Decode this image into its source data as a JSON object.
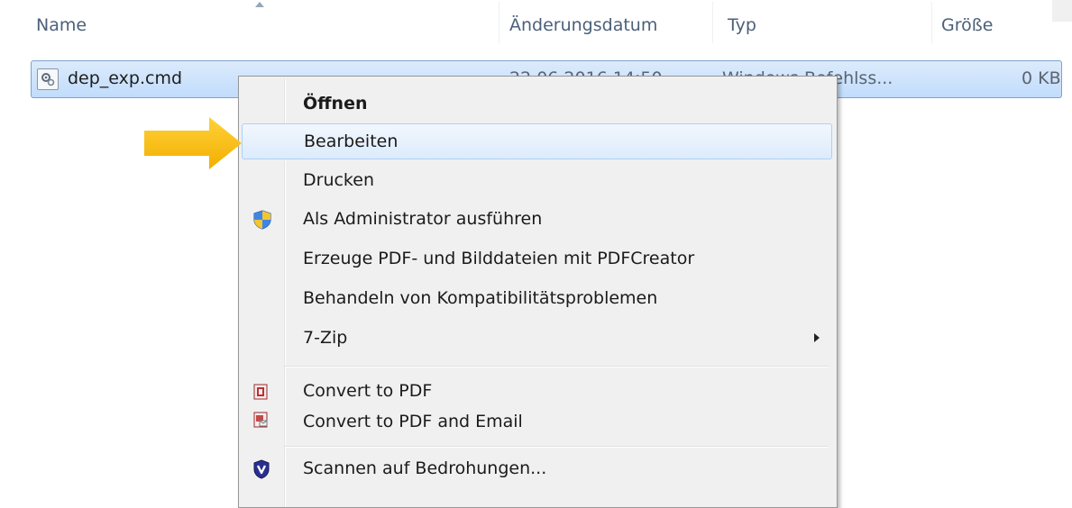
{
  "columns": {
    "name": "Name",
    "modified": "Änderungsdatum",
    "type": "Typ",
    "size": "Größe"
  },
  "file": {
    "icon": "cmd-script-icon",
    "name": "dep_exp.cmd",
    "modified": "22.06.2016 14:50",
    "type": "Windows-Befehlss...",
    "size": "0 KB"
  },
  "context_menu": {
    "items": [
      {
        "label": "Öffnen",
        "bold": true
      },
      {
        "label": "Bearbeiten",
        "highlighted": true
      },
      {
        "label": "Drucken"
      },
      {
        "label": "Als Administrator ausführen",
        "icon": "uac-shield-icon"
      },
      {
        "label": "Erzeuge PDF- und Bilddateien mit PDFCreator"
      },
      {
        "label": "Behandeln von Kompatibilitätsproblemen"
      },
      {
        "label": "7-Zip",
        "has_submenu": true
      },
      {
        "label": "Convert to PDF",
        "icon": "pdf-convert-icon"
      },
      {
        "label": "Convert to PDF and Email",
        "icon": "pdf-email-icon"
      },
      {
        "label": "Scannen auf Bedrohungen...",
        "icon": "antivirus-shield-icon"
      }
    ]
  },
  "annotation": {
    "arrow_color": "#f5b800",
    "arrow_points_to": "Bearbeiten"
  },
  "colors": {
    "selection_bg": "#cce4fc",
    "selection_border": "#7da2ce",
    "menu_bg": "#f0f0f0",
    "header_text": "#4c607a"
  }
}
